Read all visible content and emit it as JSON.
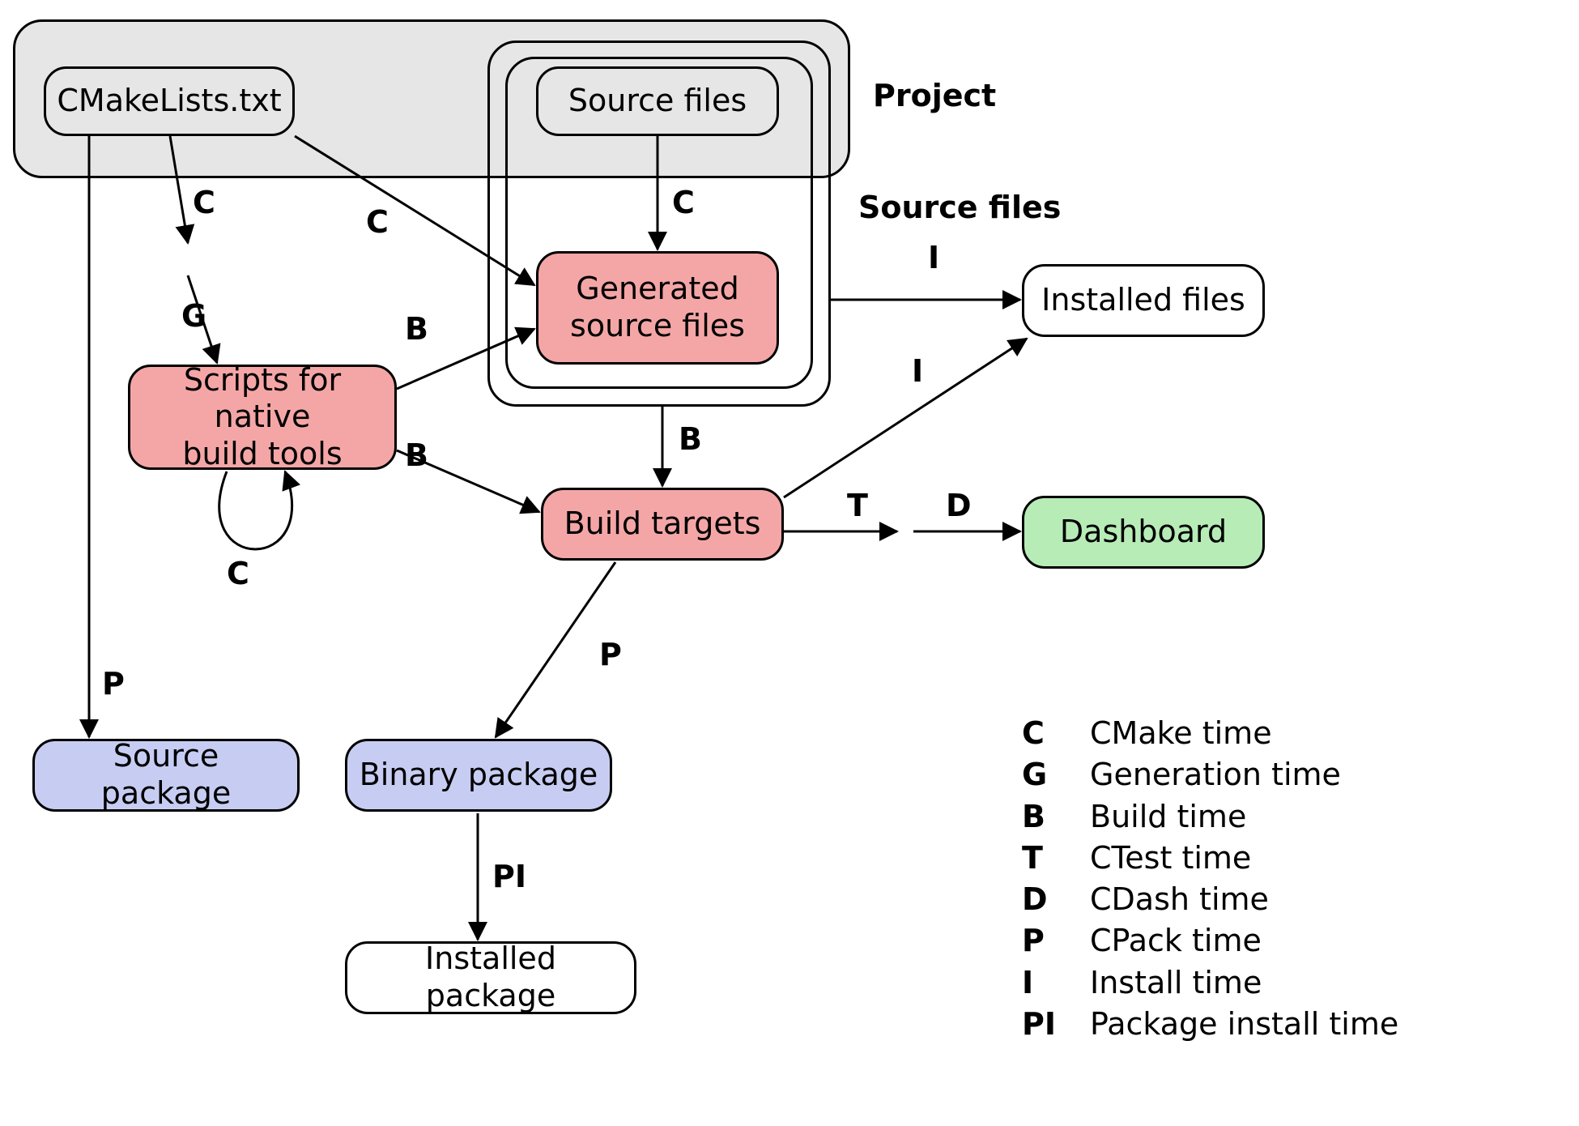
{
  "nodes": {
    "cmakelists": "CMakeLists.txt",
    "source_files_node": "Source files",
    "generated_source": "Generated\nsource files",
    "scripts": "Scripts for native\nbuild tools",
    "build_targets": "Build targets",
    "installed_files": "Installed files",
    "dashboard": "Dashboard",
    "source_package": "Source package",
    "binary_package": "Binary package",
    "installed_package": "Installed package"
  },
  "labels": {
    "project": "Project",
    "source_files": "Source files"
  },
  "edges": {
    "cmakelists_scripts": "C",
    "scripts_loop_g": "G",
    "scripts_loop_c": "C",
    "cmakelists_generated": "C",
    "source_generated": "C",
    "scripts_generated": "B",
    "scripts_build": "B",
    "generated_build": "B",
    "generated_installed": "I",
    "build_installed": "I",
    "build_dashboard_t": "T",
    "build_dashboard_d": "D",
    "cmakelists_srcpkg": "P",
    "build_binpkg": "P",
    "binpkg_instpkg": "PI"
  },
  "legend": [
    {
      "key": "C",
      "desc": "CMake time"
    },
    {
      "key": "G",
      "desc": "Generation time"
    },
    {
      "key": "B",
      "desc": "Build time"
    },
    {
      "key": "T",
      "desc": "CTest time"
    },
    {
      "key": "D",
      "desc": "CDash time"
    },
    {
      "key": "P",
      "desc": "CPack time"
    },
    {
      "key": "I",
      "desc": "Install time"
    },
    {
      "key": "PI",
      "desc": "Package install time"
    }
  ],
  "colors": {
    "grey": "#e6e6e6",
    "pink": "#f4a6a6",
    "lavender": "#c7cdf2",
    "green": "#b7ecb7"
  }
}
